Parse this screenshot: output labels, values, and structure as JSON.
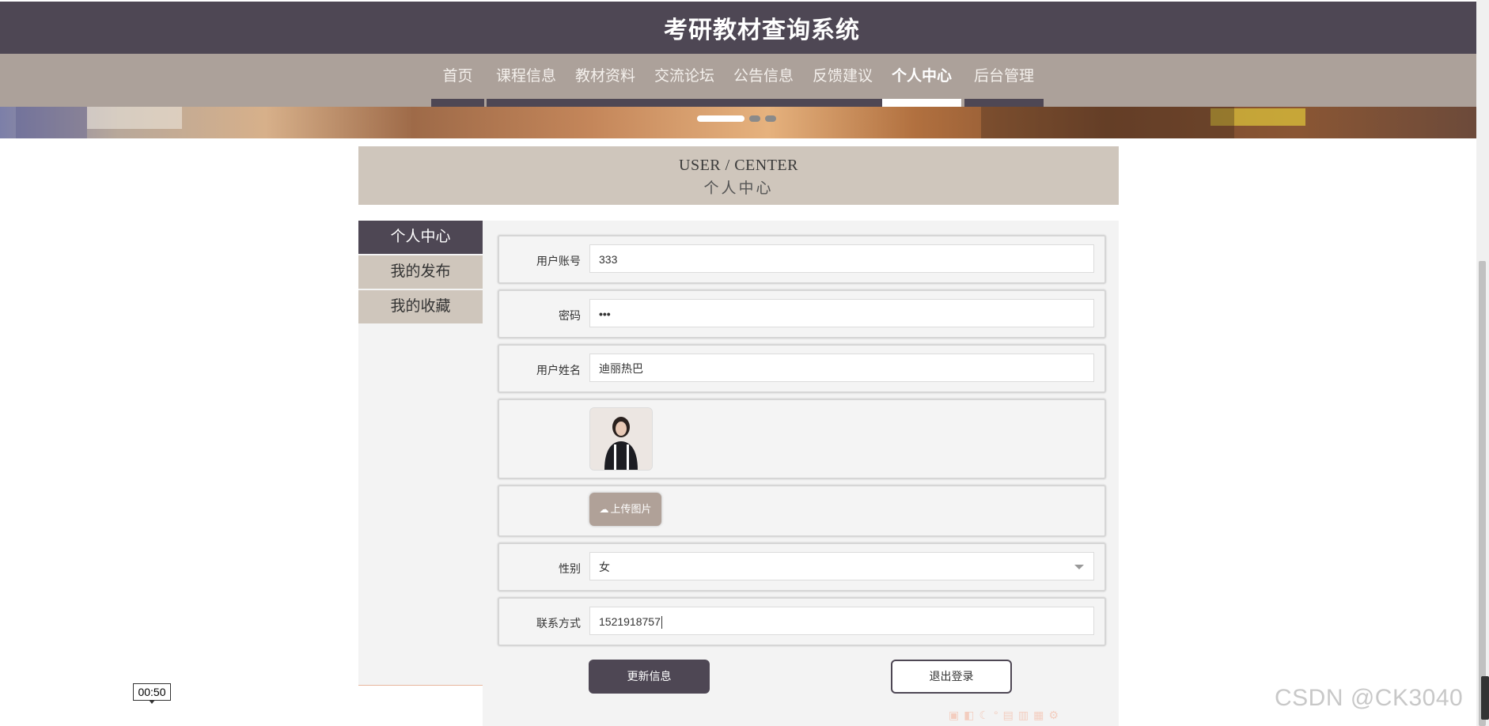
{
  "header": {
    "site_title": "考研教材查询系统"
  },
  "nav": {
    "items": [
      {
        "label": "首页"
      },
      {
        "label": "课程信息"
      },
      {
        "label": "教材资料"
      },
      {
        "label": "交流论坛"
      },
      {
        "label": "公告信息"
      },
      {
        "label": "反馈建议"
      },
      {
        "label": "个人中心"
      },
      {
        "label": "后台管理"
      }
    ],
    "active": "个人中心"
  },
  "page_header": {
    "en": "USER / CENTER",
    "cn": "个人中心"
  },
  "sidebar": {
    "items": [
      {
        "label": "个人中心"
      },
      {
        "label": "我的发布"
      },
      {
        "label": "我的收藏"
      }
    ],
    "active": "个人中心"
  },
  "form": {
    "account": {
      "label": "用户账号",
      "value": "333"
    },
    "password": {
      "label": "密码",
      "value": "•••"
    },
    "name": {
      "label": "用户姓名",
      "value": "迪丽热巴"
    },
    "upload": {
      "label": "上传图片"
    },
    "gender": {
      "label": "性别",
      "value": "女"
    },
    "contact": {
      "label": "联系方式",
      "value": "1521918757"
    }
  },
  "buttons": {
    "update": "更新信息",
    "logout": "退出登录"
  },
  "overlay": {
    "timer": "00:50",
    "watermark": "CSDN @CK3040"
  },
  "colors": {
    "primary": "#4e4754",
    "nav_bg": "#aca19a",
    "panel_bg": "#cfc6bc",
    "accent_btn": "#b0a198"
  }
}
